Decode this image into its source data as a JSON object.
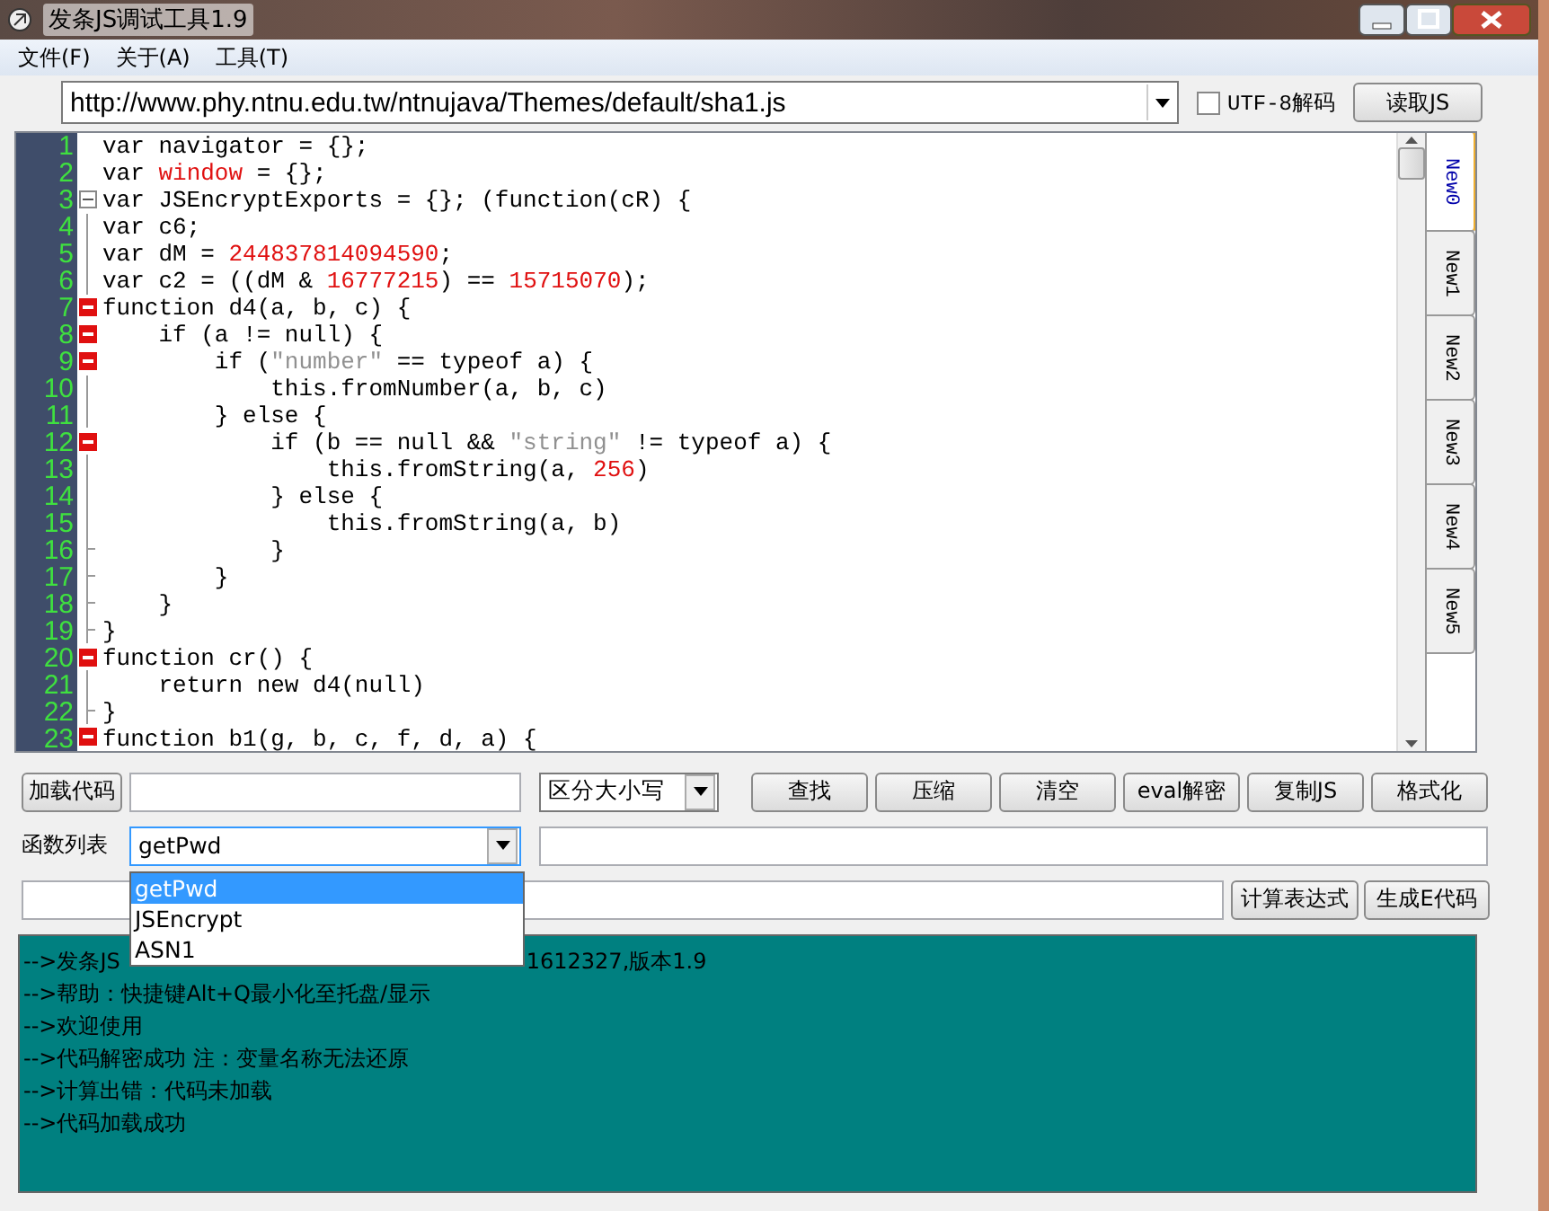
{
  "window": {
    "title": "发条JS调试工具1.9"
  },
  "menu": [
    {
      "label": "文件(F)"
    },
    {
      "label": "关于(A)"
    },
    {
      "label": "工具(T)"
    }
  ],
  "url_bar": {
    "value": "http://www.phy.ntnu.edu.tw/ntnujava/Themes/default/sha1.js",
    "utf8": {
      "label": "UTF-8解码",
      "checked": false
    },
    "read_button": "读取JS"
  },
  "editor": {
    "lines": [
      {
        "number": "1",
        "kind": "plain",
        "segments": [
          {
            "kind": "plain",
            "text": "var navigator = {};"
          }
        ]
      },
      {
        "number": "2",
        "kind": "plain",
        "segments": [
          {
            "kind": "plain",
            "text": "var "
          },
          {
            "kind": "global",
            "text": "window"
          },
          {
            "kind": "plain",
            "text": " = {};"
          }
        ]
      },
      {
        "number": "3",
        "kind": "fold",
        "segments": [
          {
            "kind": "plain",
            "text": "var JSEncryptExports = {}; (function(cR) {"
          }
        ]
      },
      {
        "number": "4",
        "kind": "inner",
        "segments": [
          {
            "kind": "plain",
            "text": "var c6;"
          }
        ]
      },
      {
        "number": "5",
        "kind": "inner",
        "segments": [
          {
            "kind": "plain",
            "text": "var dM = "
          },
          {
            "kind": "number",
            "text": "244837814094590"
          },
          {
            "kind": "plain",
            "text": ";"
          }
        ]
      },
      {
        "number": "6",
        "kind": "inner",
        "segments": [
          {
            "kind": "plain",
            "text": "var c2 = ((dM & "
          },
          {
            "kind": "number",
            "text": "16777215"
          },
          {
            "kind": "plain",
            "text": ") == "
          },
          {
            "kind": "number",
            "text": "15715070"
          },
          {
            "kind": "plain",
            "text": ");"
          }
        ]
      },
      {
        "number": "7",
        "kind": "marked",
        "segments": [
          {
            "kind": "plain",
            "text": "function d4(a, b, c) {"
          }
        ]
      },
      {
        "number": "8",
        "kind": "marked",
        "segments": [
          {
            "kind": "plain",
            "text": "    if (a != null) {"
          }
        ]
      },
      {
        "number": "9",
        "kind": "marked",
        "segments": [
          {
            "kind": "plain",
            "text": "        if ("
          },
          {
            "kind": "string",
            "text": "\"number\""
          },
          {
            "kind": "plain",
            "text": " == typeof a) {"
          }
        ]
      },
      {
        "number": "10",
        "kind": "inner",
        "segments": [
          {
            "kind": "plain",
            "text": "            this.fromNumber(a, b, c)"
          }
        ]
      },
      {
        "number": "11",
        "kind": "inner",
        "segments": [
          {
            "kind": "plain",
            "text": "        } else {"
          }
        ]
      },
      {
        "number": "12",
        "kind": "marked",
        "segments": [
          {
            "kind": "plain",
            "text": "            if (b == null && "
          },
          {
            "kind": "string",
            "text": "\"string\""
          },
          {
            "kind": "plain",
            "text": " != typeof a) {"
          }
        ]
      },
      {
        "number": "13",
        "kind": "inner",
        "segments": [
          {
            "kind": "plain",
            "text": "                this.fromString(a, "
          },
          {
            "kind": "number",
            "text": "256"
          },
          {
            "kind": "plain",
            "text": ")"
          }
        ]
      },
      {
        "number": "14",
        "kind": "inner",
        "segments": [
          {
            "kind": "plain",
            "text": "            } else {"
          }
        ]
      },
      {
        "number": "15",
        "kind": "inner",
        "segments": [
          {
            "kind": "plain",
            "text": "                this.fromString(a, b)"
          }
        ]
      },
      {
        "number": "16",
        "kind": "end",
        "segments": [
          {
            "kind": "plain",
            "text": "            }"
          }
        ]
      },
      {
        "number": "17",
        "kind": "end",
        "segments": [
          {
            "kind": "plain",
            "text": "        }"
          }
        ]
      },
      {
        "number": "18",
        "kind": "end",
        "segments": [
          {
            "kind": "plain",
            "text": "    }"
          }
        ]
      },
      {
        "number": "19",
        "kind": "end",
        "segments": [
          {
            "kind": "plain",
            "text": "}"
          }
        ]
      },
      {
        "number": "20",
        "kind": "marked",
        "segments": [
          {
            "kind": "plain",
            "text": "function cr() {"
          }
        ]
      },
      {
        "number": "21",
        "kind": "inner",
        "segments": [
          {
            "kind": "plain",
            "text": "    return new d4(null)"
          }
        ]
      },
      {
        "number": "22",
        "kind": "end",
        "segments": [
          {
            "kind": "plain",
            "text": "}"
          }
        ]
      },
      {
        "number": "23",
        "kind": "marked",
        "segments": [
          {
            "kind": "plain",
            "text": "function b1(g, b, c, f, d, a) {"
          }
        ]
      }
    ]
  },
  "tabs": [
    {
      "label": "New0",
      "selected": true
    },
    {
      "label": "New1",
      "selected": false
    },
    {
      "label": "New2",
      "selected": false
    },
    {
      "label": "New3",
      "selected": false
    },
    {
      "label": "New4",
      "selected": false
    },
    {
      "label": "New5",
      "selected": false
    }
  ],
  "toolbar": {
    "load_button": "加载代码",
    "case_select": "区分大小写",
    "buttons": [
      "查找",
      "压缩",
      "清空",
      "eval解密",
      "复制JS",
      "格式化"
    ]
  },
  "function_list": {
    "label": "函数列表",
    "value": "getPwd",
    "expanded": true,
    "items": [
      {
        "label": "getPwd",
        "selected": true
      },
      {
        "label": "JSEncrypt",
        "selected": false
      },
      {
        "label": "ASN1",
        "selected": false
      }
    ]
  },
  "expression_row": {
    "buttons": [
      "计算表达式",
      "生成E代码"
    ]
  },
  "log": {
    "lines": [
      {
        "parts": [
          "-->发条JS",
          "1612327,版本1.9"
        ]
      },
      {
        "parts": [
          "-->帮助：快捷键Alt+Q最小化至托盘/显示"
        ]
      },
      {
        "parts": [
          "-->欢迎使用"
        ]
      },
      {
        "parts": [
          "-->代码解密成功 注：变量名称无法还原"
        ]
      },
      {
        "parts": [
          "-->计算出错：代码未加载"
        ]
      },
      {
        "parts": [
          "-->代码加载成功"
        ]
      }
    ]
  }
}
